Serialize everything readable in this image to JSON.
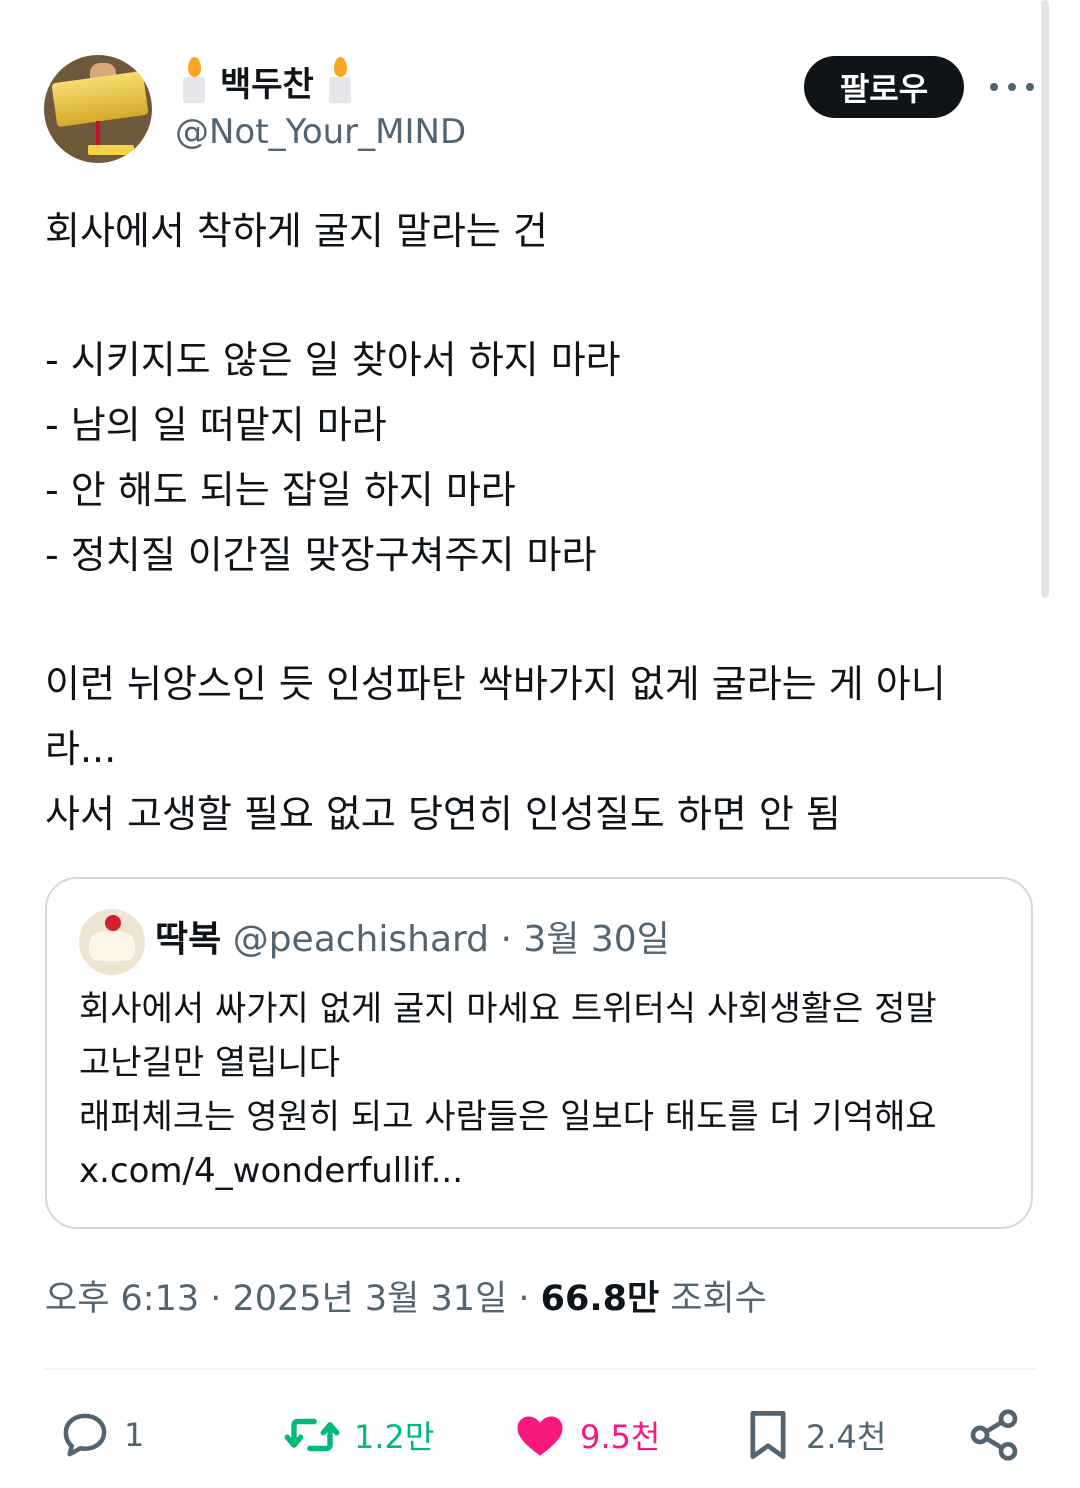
{
  "author": {
    "display_name": "백두찬",
    "handle": "@Not_Your_MIND",
    "avatar_icon": "profile-photo-gold-bar",
    "name_emoji": "candle-emoji"
  },
  "actions_top": {
    "follow_label": "팔로우",
    "more_icon": "more-horizontal-icon"
  },
  "tweet": {
    "lines": [
      "회사에서 착하게 굴지 말라는 건",
      "- 시키지도 않은 일 찾아서 하지 마라",
      "- 남의 일 떠맡지 마라",
      "- 안 해도 되는 잡일 하지 마라",
      "- 정치질 이간질 맞장구쳐주지 마라",
      "이런 뉘앙스인 듯 인성파탄 싹바가지 없게 굴라는 게 아니",
      "라...",
      "사서 고생할 필요 없고 당연히 인성질도 하면 안 됨"
    ]
  },
  "quote": {
    "display_name": "딱복",
    "handle": "@peachishard",
    "date": "· 3월 30일",
    "lines": [
      "회사에서 싸가지 없게 굴지 마세요 트위터식 사회생활은 정말",
      "고난길만 열립니다",
      "래퍼체크는 영원히 되고 사람들은 일보다 태도를 더 기억해요",
      "x.com/4_wonderfullif..."
    ]
  },
  "meta": {
    "time_date": "오후 6:13 · 2025년 3월 31일 · ",
    "views_count": "66.8만",
    "views_label": " 조회수"
  },
  "stats": {
    "replies": "1",
    "retweets": "1.2만",
    "likes": "9.5천",
    "bookmarks": "2.4천"
  },
  "colors": {
    "text": "#0f1419",
    "secondary": "#536471",
    "retweet_green": "#00ba7c",
    "like_pink": "#f91880",
    "border": "#cfd9de"
  }
}
